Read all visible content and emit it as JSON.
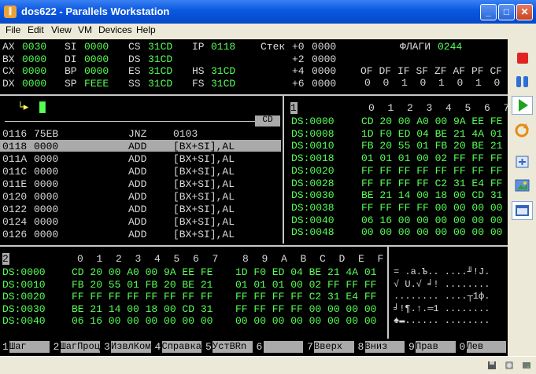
{
  "window": {
    "title": "dos622 - Parallels Workstation",
    "icon_label": "∥"
  },
  "menu": [
    "File",
    "Edit",
    "View",
    "VM",
    "Devices",
    "Help"
  ],
  "registers": {
    "rows": [
      [
        "AX",
        "0030",
        "SI",
        "0000",
        "CS",
        "31CD",
        "IP",
        "0118"
      ],
      [
        "BX",
        "0000",
        "DI",
        "0000",
        "DS",
        "31CD",
        "",
        ""
      ],
      [
        "CX",
        "0000",
        "BP",
        "0000",
        "ES",
        "31CD",
        "HS",
        "31CD"
      ],
      [
        "DX",
        "0000",
        "SP",
        "FEEE",
        "SS",
        "31CD",
        "FS",
        "31CD"
      ]
    ]
  },
  "stack": {
    "label": "Стек",
    "rows": [
      [
        "+0",
        "0000"
      ],
      [
        "+2",
        "0000"
      ],
      [
        "+4",
        "0000"
      ],
      [
        "+6",
        "0000"
      ]
    ]
  },
  "flags": {
    "label": "ФЛАГИ",
    "value": "0244",
    "names": [
      "OF",
      "DF",
      "IF",
      "SF",
      "ZF",
      "AF",
      "PF",
      "CF"
    ],
    "values": [
      "0",
      "0",
      "1",
      "0",
      "1",
      "0",
      "1",
      "0"
    ]
  },
  "command": {
    "arrow": "└▸",
    "cursor": "█"
  },
  "cd_label": "CD",
  "disasm": [
    [
      "0116",
      "75EB",
      "JNZ",
      "0103"
    ],
    [
      "0118",
      "0000",
      "ADD",
      "[BX+SI],AL"
    ],
    [
      "011A",
      "0000",
      "ADD",
      "[BX+SI],AL"
    ],
    [
      "011C",
      "0000",
      "ADD",
      "[BX+SI],AL"
    ],
    [
      "011E",
      "0000",
      "ADD",
      "[BX+SI],AL"
    ],
    [
      "0120",
      "0000",
      "ADD",
      "[BX+SI],AL"
    ],
    [
      "0122",
      "0000",
      "ADD",
      "[BX+SI],AL"
    ],
    [
      "0124",
      "0000",
      "ADD",
      "[BX+SI],AL"
    ],
    [
      "0126",
      "0000",
      "ADD",
      "[BX+SI],AL"
    ]
  ],
  "dump1": {
    "panel_number": "1",
    "header": [
      "0",
      "1",
      "2",
      "3",
      "4",
      "5",
      "6",
      "7"
    ],
    "rows": [
      {
        "addr": "DS:0000",
        "bytes": "CD 20 00 A0 00 9A EE FE"
      },
      {
        "addr": "DS:0008",
        "bytes": "1D F0 ED 04 BE 21 4A 01"
      },
      {
        "addr": "DS:0010",
        "bytes": "FB 20 55 01 FB 20 BE 21"
      },
      {
        "addr": "DS:0018",
        "bytes": "01 01 01 00 02 FF FF FF"
      },
      {
        "addr": "DS:0020",
        "bytes": "FF FF FF FF FF FF FF FF"
      },
      {
        "addr": "DS:0028",
        "bytes": "FF FF FF FF C2 31 E4 FF"
      },
      {
        "addr": "DS:0030",
        "bytes": "BE 21 14 00 18 00 CD 31"
      },
      {
        "addr": "DS:0038",
        "bytes": "FF FF FF FF 00 00 00 00"
      },
      {
        "addr": "DS:0040",
        "bytes": "06 16 00 00 00 00 00 00"
      },
      {
        "addr": "DS:0048",
        "bytes": "00 00 00 00 00 00 00 00"
      }
    ]
  },
  "dump2": {
    "panel_number": "2",
    "header": [
      "0",
      "1",
      "2",
      "3",
      "4",
      "5",
      "6",
      "7",
      "8",
      "9",
      "A",
      "B",
      "C",
      "D",
      "E",
      "F"
    ],
    "rows": [
      {
        "addr": "DS:0000",
        "left": "CD 20 00 A0 00 9A EE FE",
        "right": "1D F0 ED 04 BE 21 4A 01",
        "ascii": "= .а.Ъ.. ....╜!J."
      },
      {
        "addr": "DS:0010",
        "left": "FB 20 55 01 FB 20 BE 21",
        "right": "01 01 01 00 02 FF FF FF",
        "ascii": "√ U.√ ╛! ........"
      },
      {
        "addr": "DS:0020",
        "left": "FF FF FF FF FF FF FF FF",
        "right": "FF FF FF FF C2 31 E4 FF",
        "ascii": "........ ....┬1ф."
      },
      {
        "addr": "DS:0030",
        "left": "BE 21 14 00 18 00 CD 31",
        "right": "FF FF FF FF 00 00 00 00",
        "ascii": "╛!¶.↑.═1 ........"
      },
      {
        "addr": "DS:0040",
        "left": "06 16 00 00 00 00 00 00",
        "right": "00 00 00 00 00 00 00 00",
        "ascii": "♠▬...... ........"
      }
    ]
  },
  "fkeys": [
    {
      "num": "1",
      "label": "Шаг"
    },
    {
      "num": "2",
      "label": "ШагПроц"
    },
    {
      "num": "3",
      "label": "ИзвлКом"
    },
    {
      "num": "4",
      "label": "Справка"
    },
    {
      "num": "5",
      "label": "УстBRn"
    },
    {
      "num": "6",
      "label": ""
    },
    {
      "num": "7",
      "label": "Вверх"
    },
    {
      "num": "8",
      "label": "Вниз"
    },
    {
      "num": "9",
      "label": "Прав"
    },
    {
      "num": "0",
      "label": "Лев"
    }
  ],
  "colors": {
    "titlebar": "#0A58E0",
    "text_green": "#55FF55",
    "text_gray": "#D8D8D8",
    "highlight": "#AAAAAA",
    "stop": "#E02424",
    "play": "#1FA31F"
  },
  "sidebar_icons": [
    "stop-icon",
    "pause-icon",
    "play-icon",
    "reset-icon",
    "fullscreen-icon",
    "screenshot-icon",
    "window-icon"
  ],
  "status_icons": [
    "floppy-icon",
    "cdrom-icon",
    "harddisk-icon"
  ]
}
